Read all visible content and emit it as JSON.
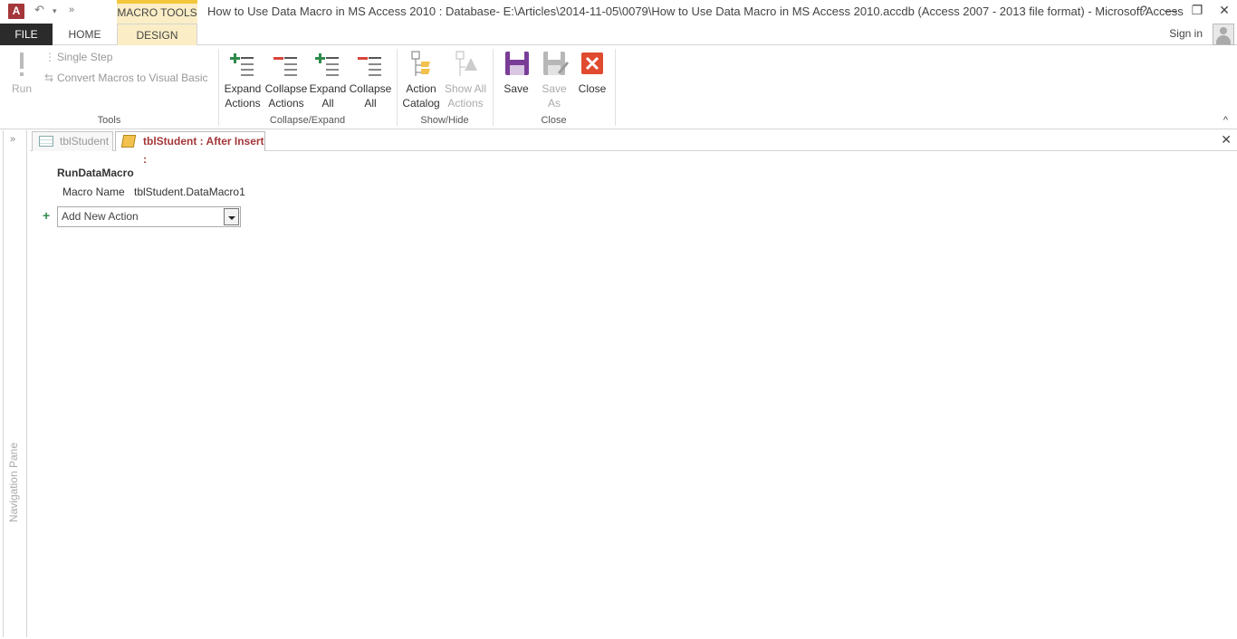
{
  "titlebar": {
    "app_icon": "A",
    "contextual_tab": "MACRO TOOLS",
    "title": "How to Use Data Macro in MS Access 2010 : Database- E:\\Articles\\2014-11-05\\0079\\How to Use Data Macro in MS Access 2010.accdb (Access 2007 - 2013 file format) - Microsoft Access",
    "help": "?",
    "minimize": "—",
    "restore": "❐",
    "close": "✕",
    "undo_icon": "undo-icon",
    "customize_icon": "qat-customize-icon"
  },
  "tabs": {
    "file": "FILE",
    "home": "HOME",
    "design": "DESIGN",
    "signin": "Sign in"
  },
  "ribbon": {
    "tools": {
      "run": "Run",
      "single_step": "Single Step",
      "convert": "Convert Macros to Visual Basic",
      "label": "Tools"
    },
    "collapse_expand": {
      "expand_actions": [
        "Expand",
        "Actions"
      ],
      "collapse_actions": [
        "Collapse",
        "Actions"
      ],
      "expand_all": [
        "Expand",
        "All"
      ],
      "collapse_all": [
        "Collapse",
        "All"
      ],
      "label": "Collapse/Expand"
    },
    "show_hide": {
      "action_catalog": [
        "Action",
        "Catalog"
      ],
      "show_all_actions": [
        "Show All",
        "Actions"
      ],
      "label": "Show/Hide"
    },
    "close_group": {
      "save": "Save",
      "save_as": [
        "Save",
        "As"
      ],
      "close": "Close",
      "label": "Close"
    },
    "collapse_ribbon": "^"
  },
  "nav_pane": {
    "label": "Navigation Pane",
    "chevron": "»"
  },
  "doc_tabs": [
    {
      "label": "tblStudent",
      "active": false
    },
    {
      "label": "tblStudent : After Insert :",
      "active": true
    }
  ],
  "doc_close": "✕",
  "macro": {
    "action": "RunDataMacro",
    "arg_label": "Macro Name",
    "arg_value": "tblStudent.DataMacro1",
    "add_new_action": "Add New Action"
  },
  "colors": {
    "accent": "#a4373a",
    "contextual": "#fbeec6",
    "contextual_border": "#f3c73c",
    "save_purple": "#7a3d97",
    "close_red": "#e04a2f",
    "green": "#2f8a4c"
  }
}
